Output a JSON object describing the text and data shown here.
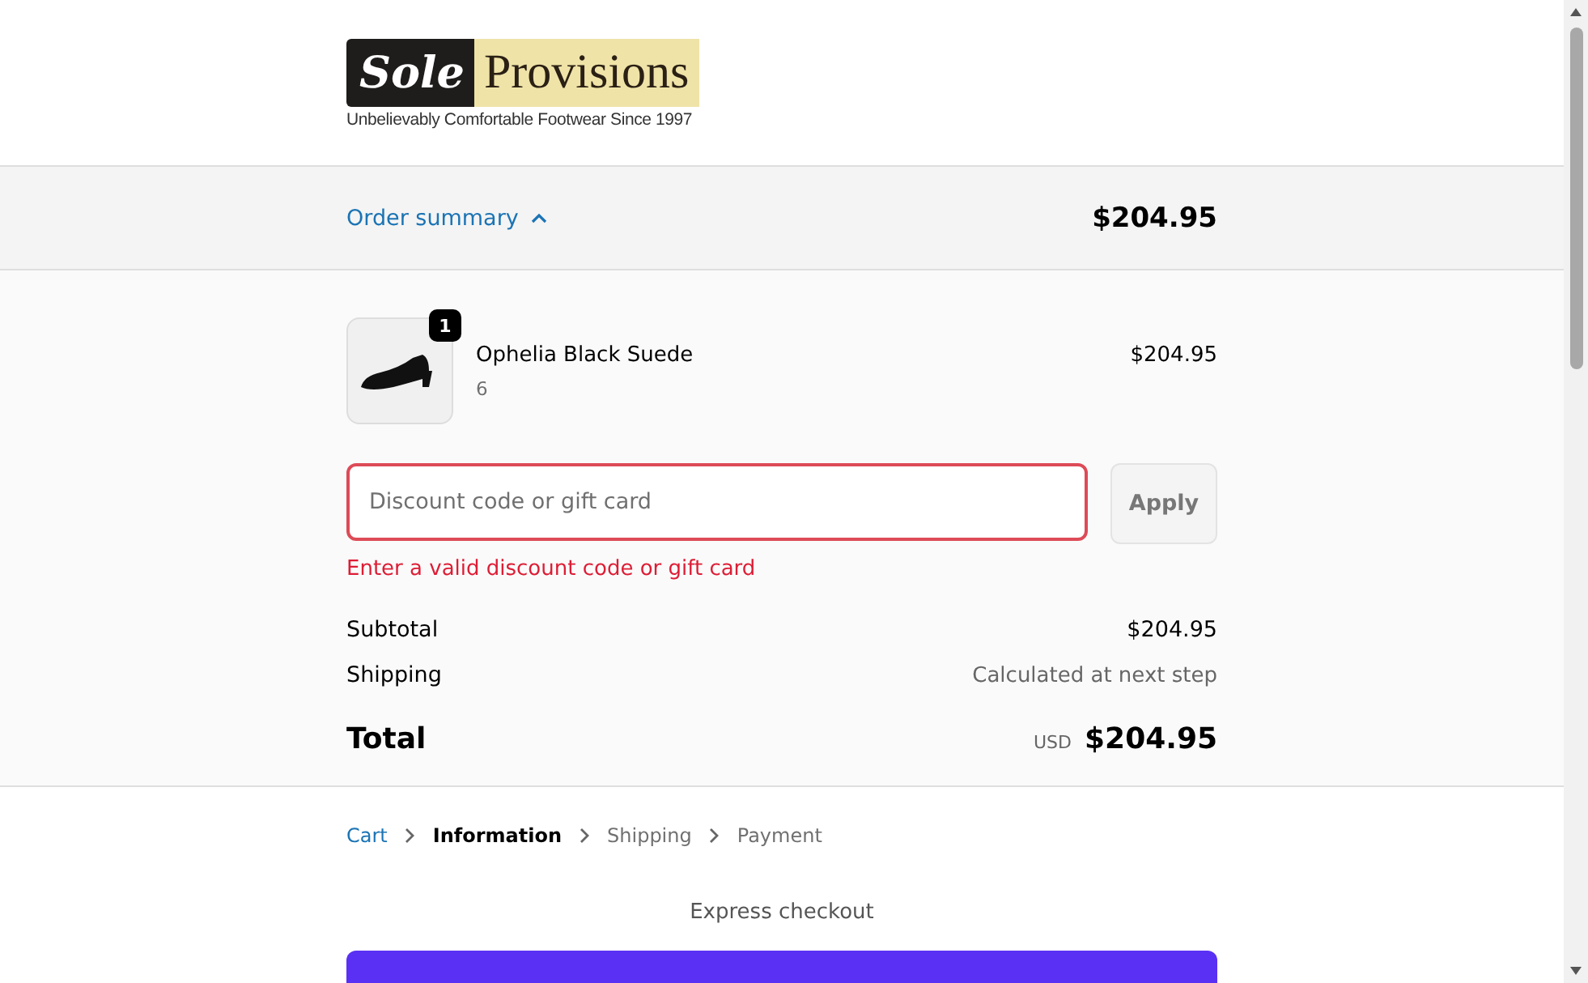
{
  "logo": {
    "word_1": "Sole",
    "word_2": "Provisions",
    "tagline": "Unbelievably Comfortable Footwear Since 1997"
  },
  "summary_bar": {
    "label": "Order summary",
    "expanded": true,
    "total": "$204.95"
  },
  "items": [
    {
      "name": "Ophelia Black Suede",
      "variant": "6",
      "quantity": "1",
      "price": "$204.95"
    }
  ],
  "discount": {
    "placeholder": "Discount code or gift card",
    "invalid": true,
    "error": "Enter a valid discount code or gift card",
    "button": "Apply",
    "disabled": true
  },
  "totals": [
    {
      "label": "Subtotal",
      "value": "$204.95",
      "kind": "line"
    },
    {
      "label": "Shipping",
      "value": "Calculated at next step",
      "kind": "note"
    },
    {
      "label": "Total",
      "currency": "USD",
      "value": "$204.95",
      "kind": "grand"
    }
  ],
  "breadcrumbs": [
    {
      "label": "Cart",
      "kind": "link"
    },
    {
      "label": "Information",
      "kind": "current"
    },
    {
      "label": "Shipping",
      "kind": "pending"
    },
    {
      "label": "Payment",
      "kind": "pending"
    }
  ],
  "express": {
    "title": "Express checkout"
  }
}
